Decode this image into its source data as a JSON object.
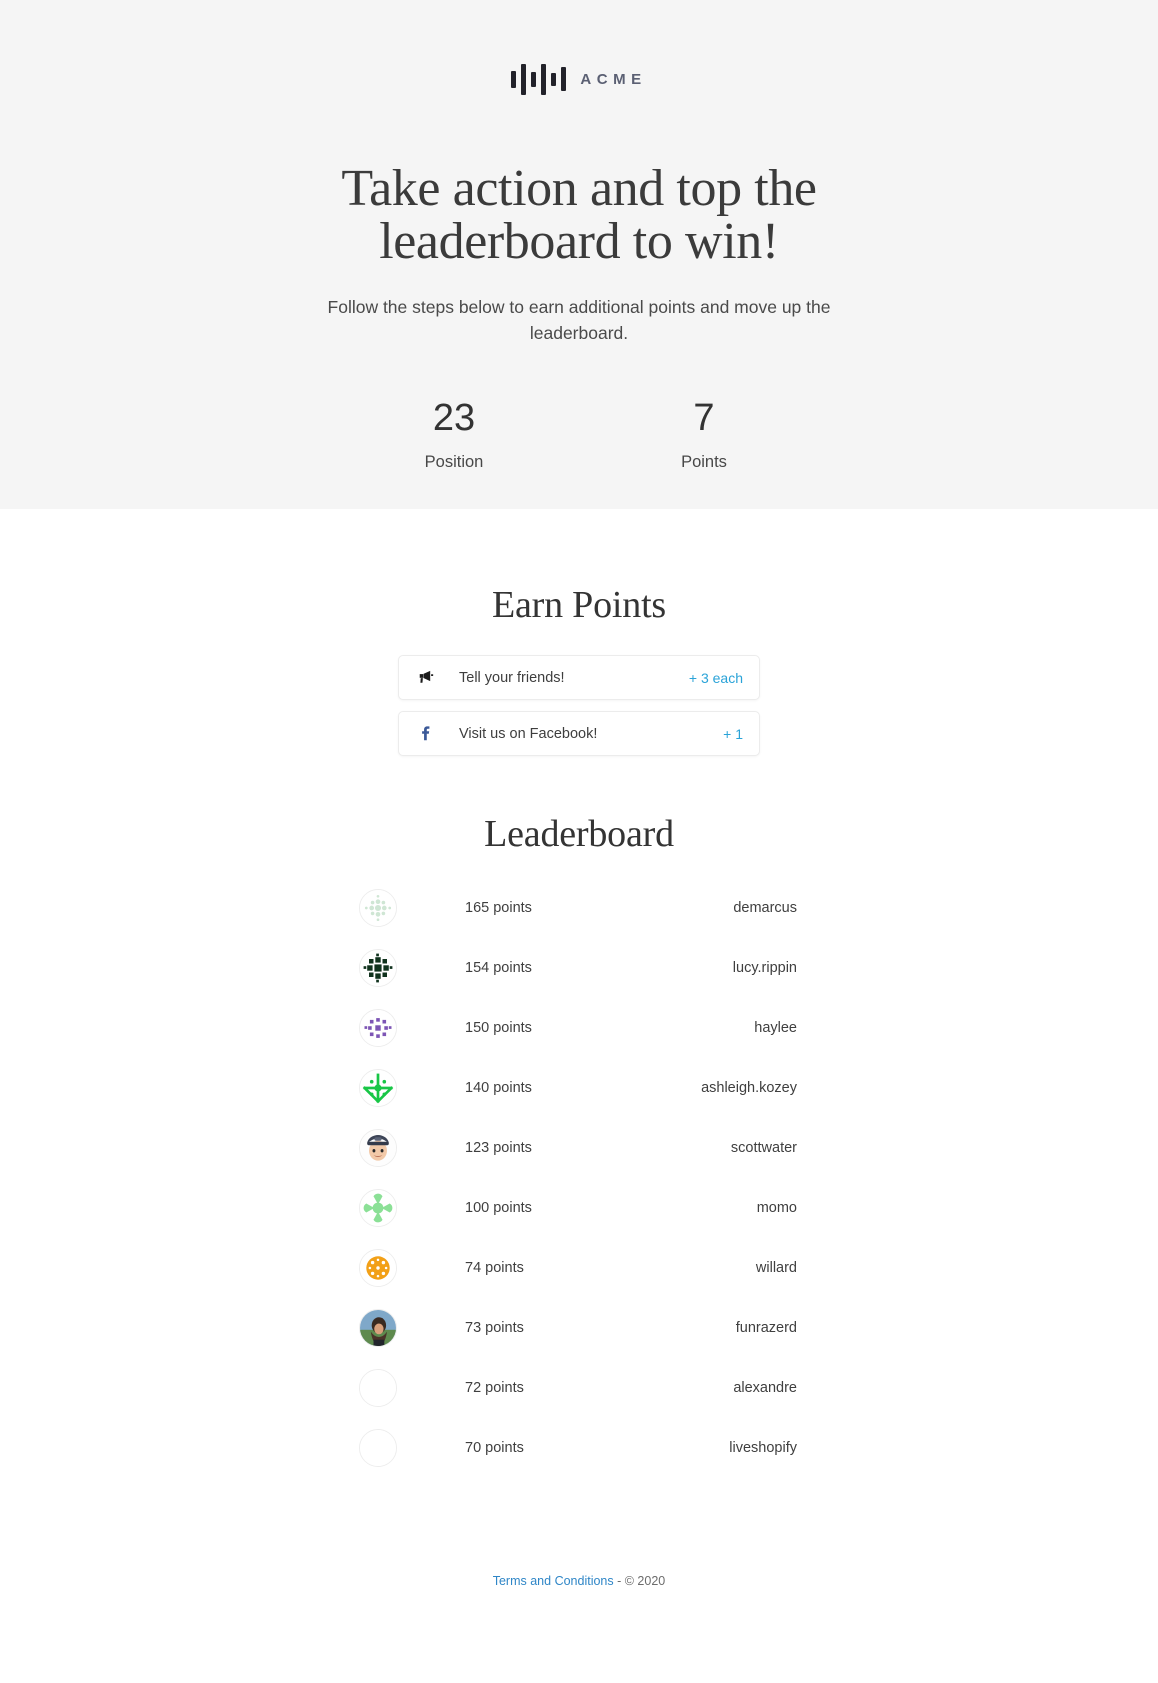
{
  "brand": {
    "name": "ACME",
    "logo_icon": "sound-bars-icon"
  },
  "hero": {
    "headline": "Take action and top the leaderboard to win!",
    "subhead": "Follow the steps below to earn additional points and move up the leaderboard.",
    "stats": [
      {
        "value": "23",
        "label": "Position"
      },
      {
        "value": "7",
        "label": "Points"
      }
    ]
  },
  "earn_points": {
    "title": "Earn Points",
    "actions": [
      {
        "icon": "megaphone-icon",
        "label": "Tell your friends!",
        "points": "+ 3 each"
      },
      {
        "icon": "facebook-icon",
        "label": "Visit us on Facebook!",
        "points": "+ 1"
      }
    ]
  },
  "leaderboard": {
    "title": "Leaderboard",
    "rows": [
      {
        "points": "165 points",
        "name": "demarcus",
        "avatar": "identicon-pale-green"
      },
      {
        "points": "154 points",
        "name": "lucy.rippin",
        "avatar": "identicon-dark-green"
      },
      {
        "points": "150 points",
        "name": "haylee",
        "avatar": "identicon-purple"
      },
      {
        "points": "140 points",
        "name": "ashleigh.kozey",
        "avatar": "identicon-bright-green"
      },
      {
        "points": "123 points",
        "name": "scottwater",
        "avatar": "photo-memoji"
      },
      {
        "points": "100 points",
        "name": "momo",
        "avatar": "identicon-light-green"
      },
      {
        "points": "74 points",
        "name": "willard",
        "avatar": "identicon-orange"
      },
      {
        "points": "73 points",
        "name": "funrazerd",
        "avatar": "photo-portrait"
      },
      {
        "points": "72 points",
        "name": "alexandre",
        "avatar": "blank-avatar"
      },
      {
        "points": "70 points",
        "name": "liveshopify",
        "avatar": "blank-avatar"
      }
    ]
  },
  "footer": {
    "link": "Terms and Conditions",
    "copyright": " - © 2020"
  },
  "colors": {
    "accent_blue": "#2aa3d8",
    "facebook_blue": "#3b5998",
    "hero_bg": "#f5f5f5",
    "link_blue": "#2f86c7"
  }
}
